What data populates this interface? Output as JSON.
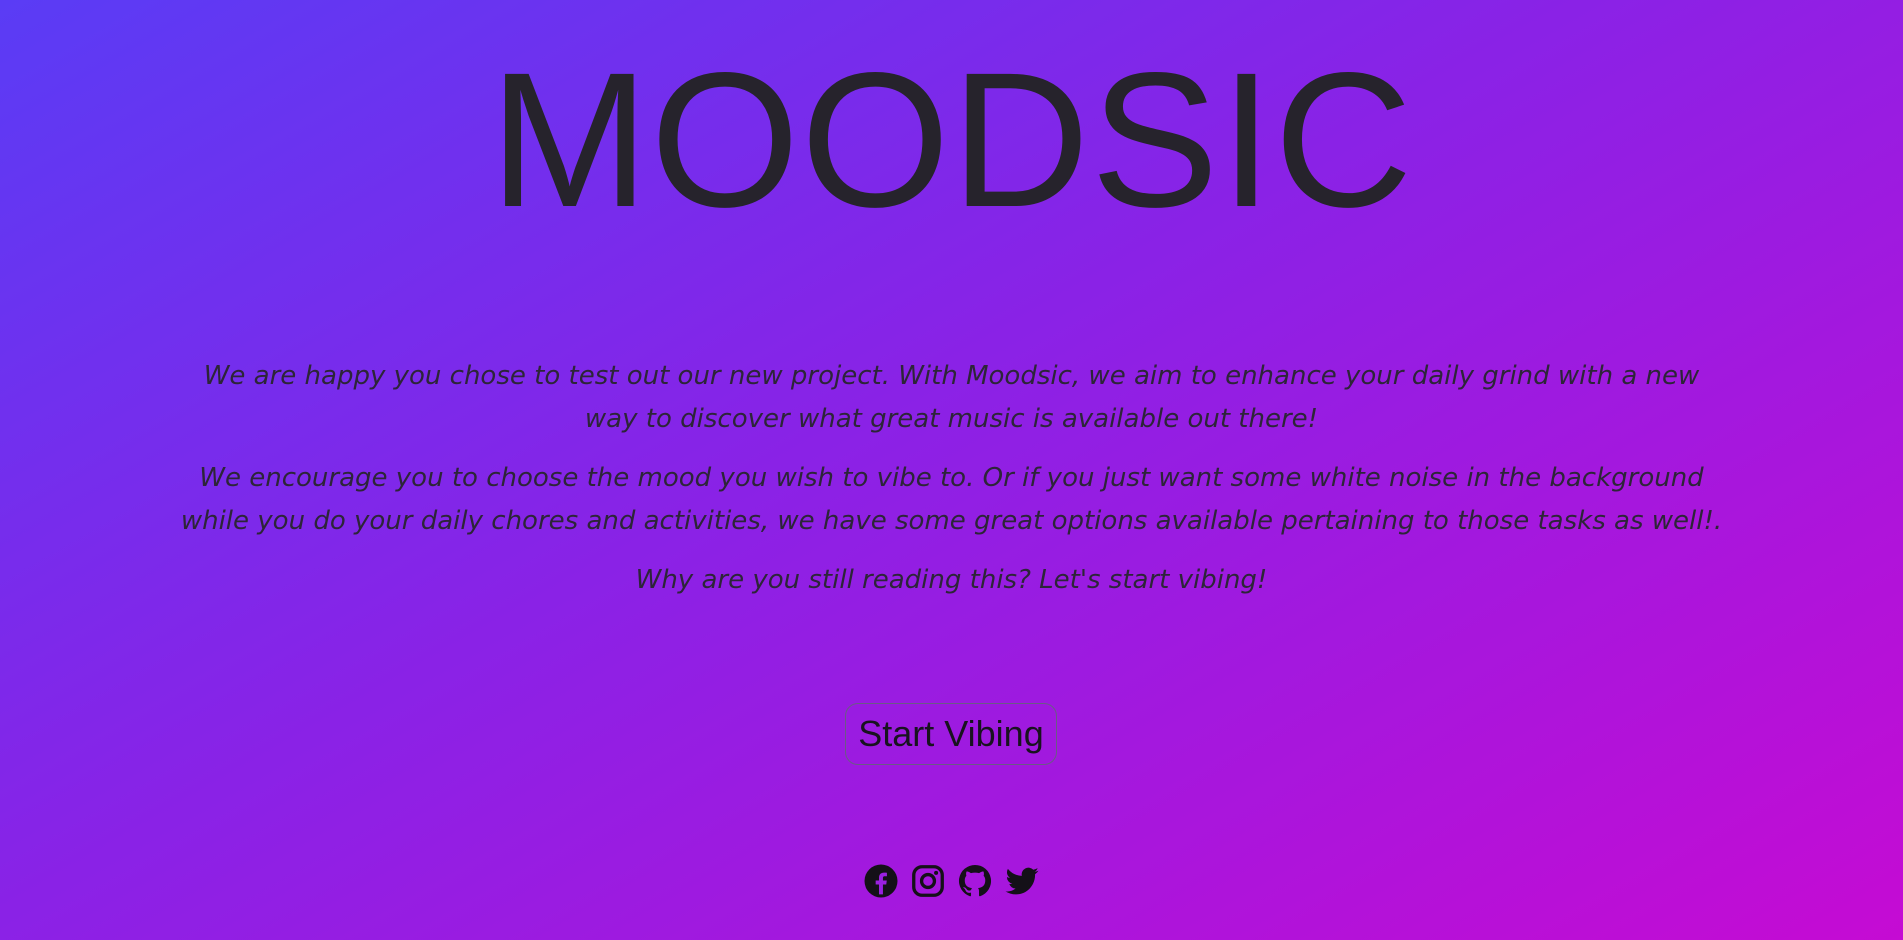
{
  "hero": {
    "title": "MOODSIC"
  },
  "intro": {
    "paragraph_1": "We are happy you chose to test out our new project. With Moodsic, we aim to enhance your daily grind with a new way to discover what great music is available out there!",
    "paragraph_2": "We encourage you to choose the mood you wish to vibe to. Or if you just want some white noise in the background while you do your daily chores and activities, we have some great options available pertaining to those tasks as well!.",
    "paragraph_3": "Why are you still reading this? Let's start vibing!"
  },
  "cta": {
    "label": "Start Vibing"
  },
  "social": {
    "icons": [
      "facebook-icon",
      "instagram-icon",
      "github-icon",
      "twitter-icon"
    ]
  },
  "theme": {
    "gradient_start": "#5a3cf5",
    "gradient_mid": "#8a22e6",
    "gradient_end": "#c50bd3",
    "text_color": "#26232c"
  }
}
